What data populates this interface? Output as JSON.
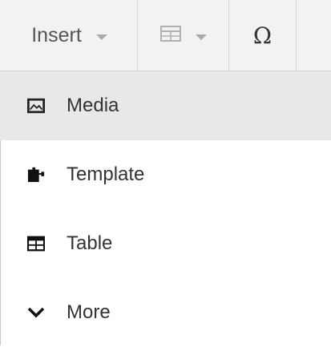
{
  "toolbar": {
    "insert_label": "Insert",
    "insert_icon": "chevron-down-icon",
    "table_icon": "table-icon",
    "special_char_label": "Ω"
  },
  "menu": {
    "items": [
      {
        "label": "Media",
        "icon": "image-icon",
        "highlighted": true
      },
      {
        "label": "Template",
        "icon": "puzzle-icon",
        "highlighted": false
      },
      {
        "label": "Table",
        "icon": "table-icon",
        "highlighted": false
      },
      {
        "label": "More",
        "icon": "chevron-down-icon",
        "highlighted": false
      }
    ]
  }
}
